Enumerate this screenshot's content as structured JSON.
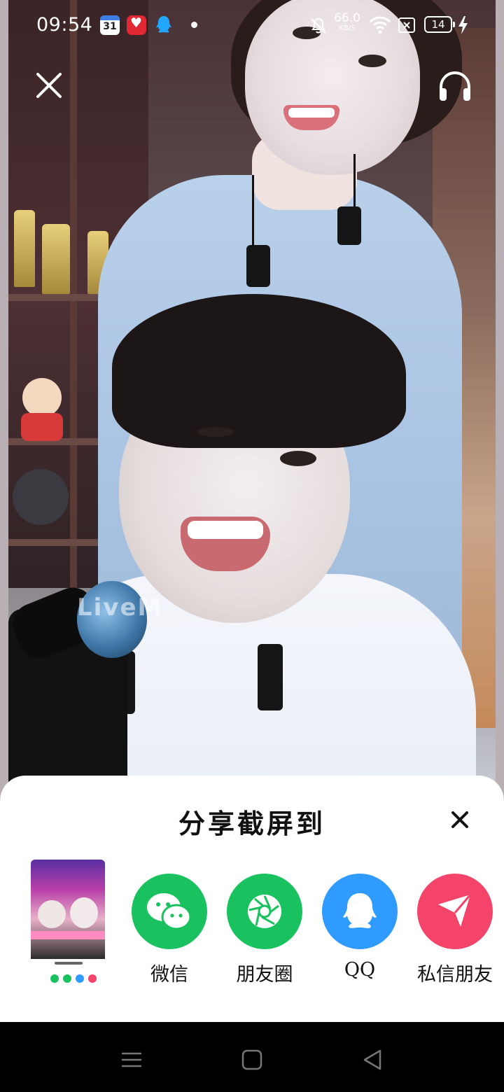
{
  "status_bar": {
    "time": "09:54",
    "calendar_day": "31",
    "net_speed_value": "66.0",
    "net_speed_unit": "KB/S",
    "battery": "14"
  },
  "video": {
    "watermark": "LiveM"
  },
  "share_sheet": {
    "title": "分享截屏到",
    "targets": [
      {
        "label": "微信",
        "icon": "wechat-icon",
        "color": "#19c25f"
      },
      {
        "label": "朋友圈",
        "icon": "moments-icon",
        "color": "#19c25f"
      },
      {
        "label": "QQ",
        "icon": "qq-icon",
        "color": "#2f9bff"
      },
      {
        "label": "私信朋友",
        "icon": "send-icon",
        "color": "#f4446a"
      }
    ]
  },
  "nav_bar": {
    "icons": [
      "menu-icon",
      "home-icon",
      "back-icon"
    ]
  }
}
